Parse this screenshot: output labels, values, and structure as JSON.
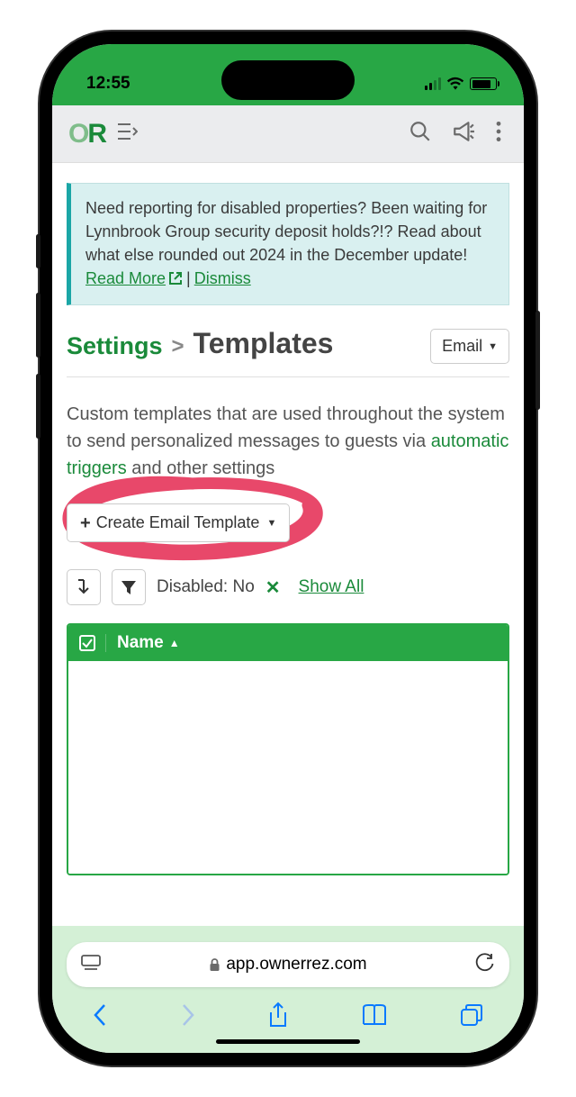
{
  "status": {
    "time": "12:55"
  },
  "header": {
    "logo_o": "O",
    "logo_r": "R"
  },
  "notice": {
    "text": "Need reporting for disabled properties? Been waiting for Lynnbrook Group security deposit holds?!? Read about what else rounded out 2024 in the December update!",
    "read_more": "Read More",
    "dismiss": "Dismiss"
  },
  "breadcrumb": {
    "settings": "Settings",
    "separator": ">",
    "title": "Templates"
  },
  "filter_dropdown": {
    "label": "Email"
  },
  "description": {
    "pre": "Custom templates that are used throughout the system to send personalized messages to guests via ",
    "link": "automatic triggers",
    "post": " and other settings"
  },
  "create_button": {
    "label": "Create Email Template"
  },
  "filters": {
    "disabled_label": "Disabled: No",
    "show_all": "Show All"
  },
  "table": {
    "name_header": "Name"
  },
  "browser": {
    "url": "app.ownerrez.com"
  }
}
